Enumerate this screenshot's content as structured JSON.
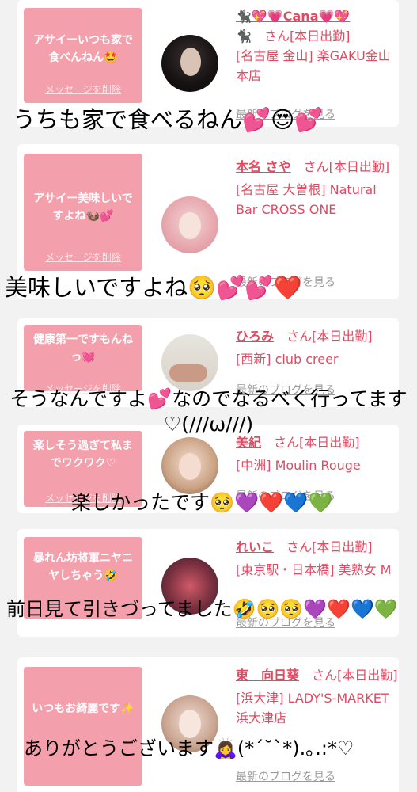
{
  "cards": [
    {
      "message": "アサイーいつも家で食べんねん🤩",
      "delete_label": "メッセージを削除",
      "name": "🐈‍⬛💖💗Cana💗💖",
      "name_suffix_icon": "🐈‍⬛",
      "san": "さん[本日出勤]",
      "shop": "[名古屋 金山] 楽GAKU金山本店",
      "blog": "最新のブログを見る",
      "overlay": "うちも家で食べるねん💕😍💕"
    },
    {
      "message": "アサイー美味しいですよね🦦💕",
      "delete_label": "メッセージを削除",
      "name": "本名 さや",
      "san": "さん[本日出勤]",
      "shop": "[名古屋 大曽根] Natural Bar CROSS ONE",
      "blog": "最新のブログを見る",
      "overlay": "美味しいですよね🥺💕💕❤️"
    },
    {
      "message": "健康第一ですもんねっ💓",
      "delete_label": "メッセージを削除",
      "name": "ひろみ",
      "san": "さん[本日出勤]",
      "shop": "[西新] club creer",
      "blog": "最新のブログを見る",
      "overlay": "そうなんですよ💕なのでなるべく行ってます♡(///ω///)"
    },
    {
      "message": "楽しそう過ぎて私までワクワク♡",
      "delete_label": "メッセージを削除",
      "name": "美紀",
      "san": "さん[本日出勤]",
      "shop": "[中洲] Moulin Rouge",
      "blog": "最新のブログを見る",
      "overlay": "楽しかったです🥺💜❤️💙💚"
    },
    {
      "message": "暴れん坊将軍ニヤニヤしちゃう🤣",
      "delete_label": "メッセージを削除",
      "name": "れいこ",
      "san": "さん[本日出勤]",
      "shop": "[東京駅・日本橋] 美熟女 M",
      "blog": "最新のブログを見る",
      "overlay": "前日見て引きづってました🤣🥺🥺💜❤️💙💚"
    },
    {
      "message": "いつもお綺麗です✨",
      "delete_label": "メッセージを削除",
      "name": "東　向日葵",
      "san": "さん[本日出勤]",
      "shop": "[浜大津] LADY'S-MARKET 浜大津店",
      "blog": "最新のブログを見る",
      "overlay": "ありがとうございます🙇‍♀️(*´˘`*).｡.:*♡"
    }
  ],
  "colors": {
    "accent": "#e04a62",
    "message_bg": "#f3a0ac",
    "page_bg": "#f2f2f2"
  }
}
